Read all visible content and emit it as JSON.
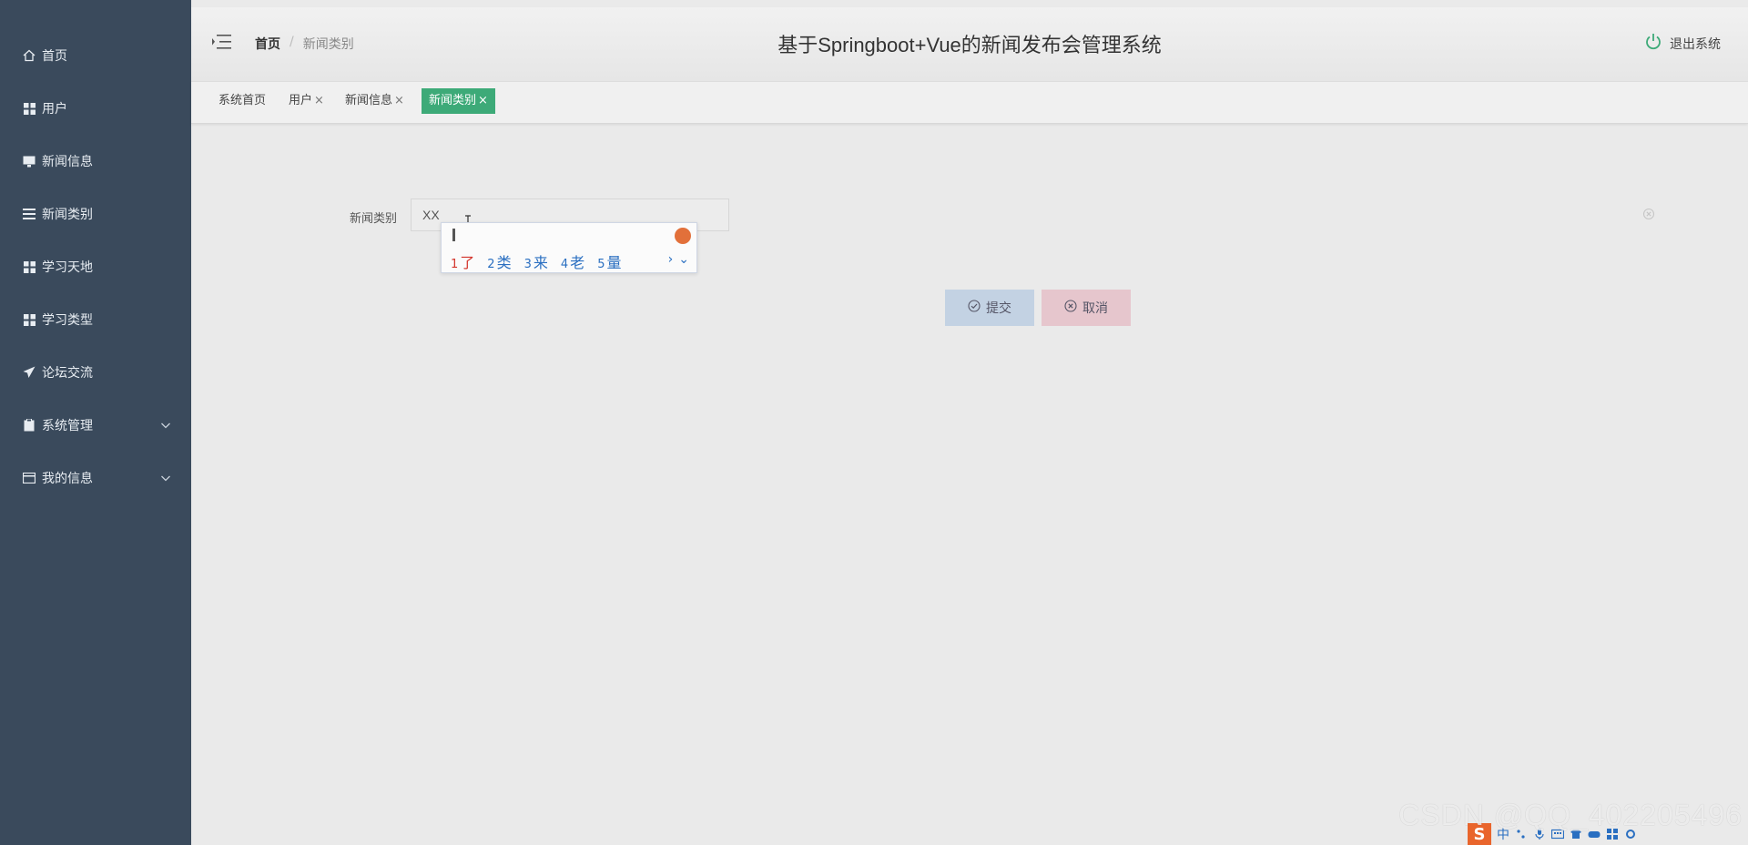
{
  "sidebar": {
    "items": [
      {
        "label": "首页",
        "icon": "home-icon"
      },
      {
        "label": "用户",
        "icon": "grid-icon"
      },
      {
        "label": "新闻信息",
        "icon": "monitor-icon"
      },
      {
        "label": "新闻类别",
        "icon": "list-icon"
      },
      {
        "label": "学习天地",
        "icon": "grid-icon"
      },
      {
        "label": "学习类型",
        "icon": "grid-icon"
      },
      {
        "label": "论坛交流",
        "icon": "paper-plane-icon"
      },
      {
        "label": "系统管理",
        "icon": "clipboard-icon",
        "expandable": true
      },
      {
        "label": "我的信息",
        "icon": "card-icon",
        "expandable": true
      }
    ]
  },
  "header": {
    "breadcrumb_home": "首页",
    "breadcrumb_sep": "/",
    "breadcrumb_current": "新闻类别",
    "title": "基于Springboot+Vue的新闻发布会管理系统",
    "logout_label": "退出系统"
  },
  "tabs": [
    {
      "label": "系统首页",
      "closable": false
    },
    {
      "label": "用户",
      "closable": true
    },
    {
      "label": "新闻信息",
      "closable": true
    },
    {
      "label": "新闻类别",
      "closable": true,
      "active": true
    }
  ],
  "tab_close_glyph": "×",
  "form": {
    "category_label": "新闻类别",
    "category_value": "XX"
  },
  "ime": {
    "candidates": [
      {
        "n": "1",
        "text": "了"
      },
      {
        "n": "2",
        "text": "类"
      },
      {
        "n": "3",
        "text": "来"
      },
      {
        "n": "4",
        "text": "老"
      },
      {
        "n": "5",
        "text": "量"
      }
    ],
    "next": "›",
    "expand": "⌄"
  },
  "buttons": {
    "submit_label": "提交",
    "cancel_label": "取消"
  },
  "watermark": "CSDN @QQ_402205496",
  "tray": {
    "logo": "S",
    "lang": "中"
  },
  "colors": {
    "sidebar_bg": "#3a4a5c",
    "active_tab": "#3daa78",
    "submit_bg": "#c3d2e3",
    "cancel_bg": "#e6c6cd"
  }
}
